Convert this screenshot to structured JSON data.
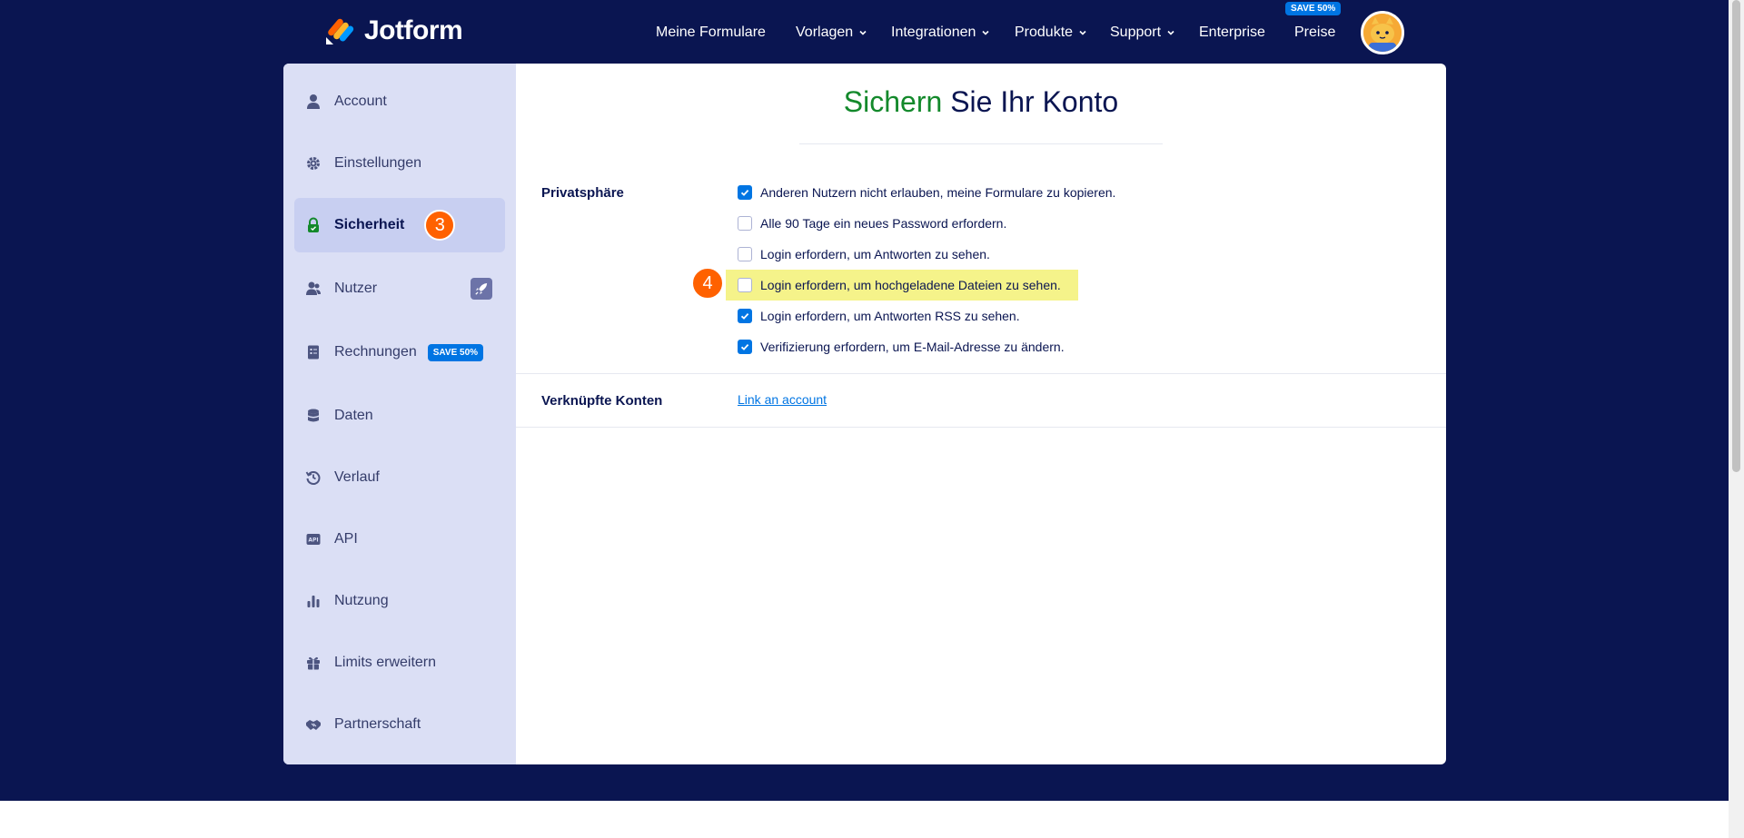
{
  "header": {
    "logo_text": "Jotform",
    "nav": [
      {
        "label": "Meine Formulare",
        "dropdown": false
      },
      {
        "label": "Vorlagen",
        "dropdown": true
      },
      {
        "label": "Integrationen",
        "dropdown": true
      },
      {
        "label": "Produkte",
        "dropdown": true
      },
      {
        "label": "Support",
        "dropdown": true
      },
      {
        "label": "Enterprise",
        "dropdown": false
      },
      {
        "label": "Preise",
        "dropdown": false
      }
    ],
    "save_badge": "SAVE 50%",
    "avatar_icon": "cat-avatar-icon"
  },
  "sidebar": {
    "items": [
      {
        "label": "Account",
        "icon": "user-icon"
      },
      {
        "label": "Einstellungen",
        "icon": "gear-icon"
      },
      {
        "label": "Sicherheit",
        "icon": "lock-icon",
        "active": true,
        "step": "3"
      },
      {
        "label": "Nutzer",
        "icon": "users-icon",
        "extra_icon": "rocket-icon"
      },
      {
        "label": "Rechnungen",
        "icon": "invoice-icon",
        "badge": "SAVE 50%"
      },
      {
        "label": "Daten",
        "icon": "database-icon"
      },
      {
        "label": "Verlauf",
        "icon": "history-icon"
      },
      {
        "label": "API",
        "icon": "api-icon"
      },
      {
        "label": "Nutzung",
        "icon": "bar-chart-icon"
      },
      {
        "label": "Limits erweitern",
        "icon": "gift-icon"
      },
      {
        "label": "Partnerschaft",
        "icon": "handshake-icon"
      }
    ]
  },
  "main": {
    "title_highlight": "Sichern",
    "title_rest": " Sie Ihr Konto",
    "privacy": {
      "label": "Privatsphäre",
      "options": [
        {
          "label": "Anderen Nutzern nicht erlauben, meine Formulare zu kopieren.",
          "checked": true
        },
        {
          "label": "Alle 90 Tage ein neues Password erfordern.",
          "checked": false
        },
        {
          "label": "Login erfordern, um Antworten zu sehen.",
          "checked": false
        },
        {
          "label": "Login erfordern, um hochgeladene Dateien zu sehen.",
          "checked": false,
          "highlighted": true,
          "step": "4"
        },
        {
          "label": "Login erfordern, um Antworten RSS zu sehen.",
          "checked": true
        },
        {
          "label": "Verifizierung erfordern, um E-Mail-Adresse zu ändern.",
          "checked": true
        }
      ]
    },
    "linked": {
      "label": "Verknüpfte Konten",
      "link": "Link an account"
    }
  },
  "colors": {
    "navy": "#0a1551",
    "accent_blue": "#0075e3",
    "green": "#13892b",
    "orange": "#ff6100",
    "highlight": "#f5f38a"
  }
}
